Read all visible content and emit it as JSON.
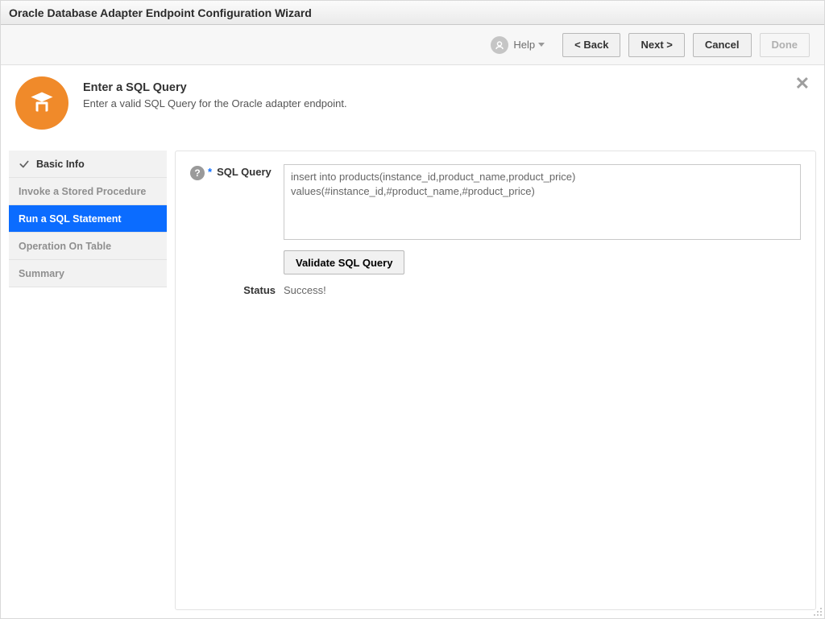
{
  "window": {
    "title": "Oracle Database Adapter Endpoint Configuration Wizard"
  },
  "toolbar": {
    "help_label": "Help",
    "back_label": "<  Back",
    "next_label": "Next  >",
    "cancel_label": "Cancel",
    "done_label": "Done"
  },
  "panel": {
    "title": "Enter a SQL Query",
    "subtitle": "Enter a valid SQL Query for the Oracle adapter endpoint."
  },
  "sidebar": {
    "items": [
      {
        "label": "Basic Info",
        "state": "done"
      },
      {
        "label": "Invoke a Stored Procedure",
        "state": "future"
      },
      {
        "label": "Run a SQL Statement",
        "state": "active"
      },
      {
        "label": "Operation On Table",
        "state": "future"
      },
      {
        "label": "Summary",
        "state": "future"
      }
    ]
  },
  "form": {
    "sql_label": "SQL Query",
    "sql_value": "insert into products(instance_id,product_name,product_price) values(#instance_id,#product_name,#product_price)",
    "validate_label": "Validate SQL Query",
    "status_label": "Status",
    "status_value": "Success!"
  }
}
